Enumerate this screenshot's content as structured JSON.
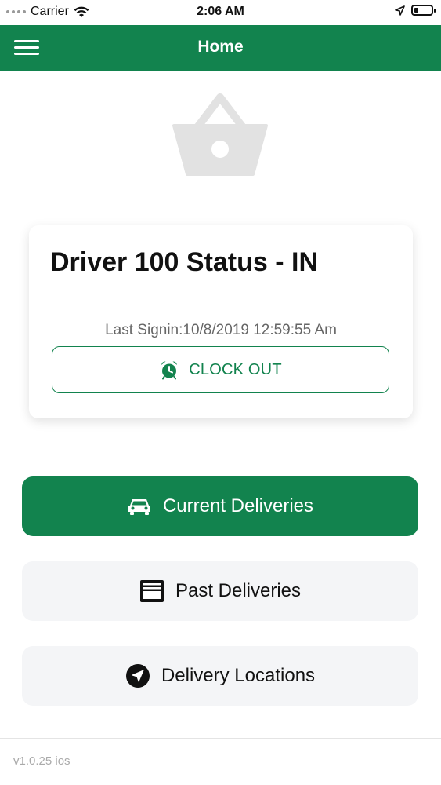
{
  "status_bar": {
    "carrier": "Carrier",
    "time": "2:06 AM"
  },
  "nav": {
    "title": "Home"
  },
  "status_card": {
    "title": "Driver 100 Status - IN",
    "last_signin": "Last Signin:10/8/2019 12:59:55 Am",
    "clock_out_label": "CLOCK OUT"
  },
  "menu": {
    "current_deliveries": "Current Deliveries",
    "past_deliveries": "Past Deliveries",
    "delivery_locations": "Delivery Locations"
  },
  "footer": {
    "version": "v1.0.25 ios"
  },
  "colors": {
    "brand_green": "#12834e",
    "button_gray": "#f4f5f7",
    "basket_gray": "#e2e2e2"
  },
  "icons": {
    "menu": "hamburger-icon",
    "basket": "basket-icon",
    "clock": "alarm-clock-icon",
    "current": "car-icon",
    "past": "archive-box-icon",
    "locations": "navigation-arrow-icon"
  }
}
